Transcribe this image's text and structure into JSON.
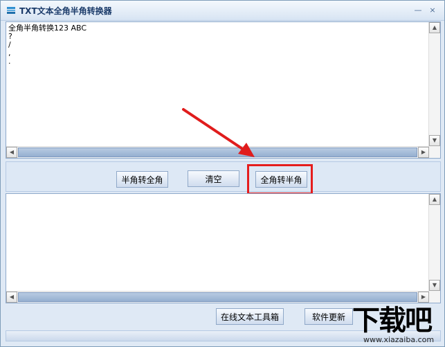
{
  "window": {
    "title": "TXT文本全角半角转换器",
    "minimize_glyph": "—",
    "close_glyph": "×"
  },
  "input_box": {
    "lines": [
      "全角半角转换123 ABC",
      "?",
      "/",
      ",",
      "."
    ]
  },
  "output_box": {
    "lines": []
  },
  "buttons": {
    "half_to_full": "半角转全角",
    "clear": "清空",
    "full_to_half": "全角转半角",
    "online_tools": "在线文本工具箱",
    "software_update": "软件更新"
  },
  "icons": {
    "app": "app-icon",
    "arrow": "red-pointer-arrow",
    "highlight_color": "#e51d1d"
  },
  "watermark": {
    "brand": "下载吧",
    "url": "www.xiazaiba.com"
  }
}
